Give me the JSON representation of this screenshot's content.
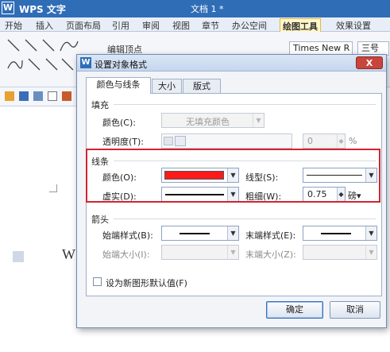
{
  "app": {
    "name": "WPS 文字",
    "doc_title": "文档 1 *"
  },
  "menu": [
    "开始",
    "插入",
    "页面布局",
    "引用",
    "审阅",
    "视图",
    "章节",
    "办公空间",
    "绘图工具",
    "效果设置"
  ],
  "menu_active": "绘图工具",
  "ribbon": {
    "edit_vertex": "编辑顶点",
    "font_name": "Times New R",
    "font_size": "三号"
  },
  "dialog": {
    "title": "设置对象格式",
    "close": "X",
    "tabs": [
      "颜色与线条",
      "大小",
      "版式"
    ],
    "fill": {
      "header": "填充",
      "color_label": "颜色(C):",
      "color_value": "无填充颜色",
      "transparency_label": "透明度(T):",
      "transparency_value": "0",
      "percent": "%"
    },
    "line": {
      "header": "线条",
      "color_label": "颜色(O):",
      "color_value": "#ff1a1a",
      "linetype_label": "线型(S):",
      "dash_label": "虚实(D):",
      "weight_label": "粗细(W):",
      "weight_value": "0.75",
      "weight_unit": "磅"
    },
    "arrows": {
      "header": "箭头",
      "begin_style_label": "始端样式(B):",
      "end_style_label": "末端样式(E):",
      "begin_size_label": "始端大小(I):",
      "end_size_label": "末端大小(Z):"
    },
    "default_checkbox": "设为新图形默认值(F)",
    "ok": "确定",
    "cancel": "取消"
  }
}
